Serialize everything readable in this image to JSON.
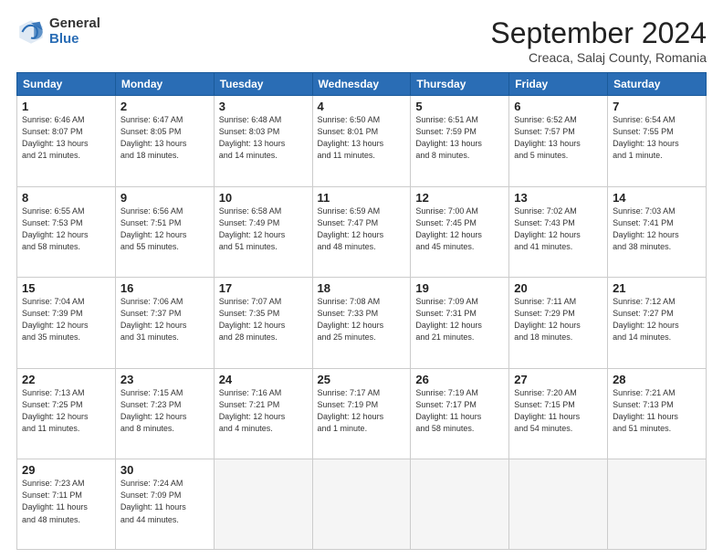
{
  "logo": {
    "general": "General",
    "blue": "Blue"
  },
  "title": "September 2024",
  "subtitle": "Creaca, Salaj County, Romania",
  "headers": [
    "Sunday",
    "Monday",
    "Tuesday",
    "Wednesday",
    "Thursday",
    "Friday",
    "Saturday"
  ],
  "days": [
    {
      "num": "",
      "info": ""
    },
    {
      "num": "",
      "info": ""
    },
    {
      "num": "",
      "info": ""
    },
    {
      "num": "",
      "info": ""
    },
    {
      "num": "",
      "info": ""
    },
    {
      "num": "",
      "info": ""
    },
    {
      "num": "1",
      "info": "Sunrise: 6:46 AM\nSunset: 8:07 PM\nDaylight: 13 hours\nand 21 minutes."
    },
    {
      "num": "2",
      "info": "Sunrise: 6:47 AM\nSunset: 8:05 PM\nDaylight: 13 hours\nand 18 minutes."
    },
    {
      "num": "3",
      "info": "Sunrise: 6:48 AM\nSunset: 8:03 PM\nDaylight: 13 hours\nand 14 minutes."
    },
    {
      "num": "4",
      "info": "Sunrise: 6:50 AM\nSunset: 8:01 PM\nDaylight: 13 hours\nand 11 minutes."
    },
    {
      "num": "5",
      "info": "Sunrise: 6:51 AM\nSunset: 7:59 PM\nDaylight: 13 hours\nand 8 minutes."
    },
    {
      "num": "6",
      "info": "Sunrise: 6:52 AM\nSunset: 7:57 PM\nDaylight: 13 hours\nand 5 minutes."
    },
    {
      "num": "7",
      "info": "Sunrise: 6:54 AM\nSunset: 7:55 PM\nDaylight: 13 hours\nand 1 minute."
    },
    {
      "num": "8",
      "info": "Sunrise: 6:55 AM\nSunset: 7:53 PM\nDaylight: 12 hours\nand 58 minutes."
    },
    {
      "num": "9",
      "info": "Sunrise: 6:56 AM\nSunset: 7:51 PM\nDaylight: 12 hours\nand 55 minutes."
    },
    {
      "num": "10",
      "info": "Sunrise: 6:58 AM\nSunset: 7:49 PM\nDaylight: 12 hours\nand 51 minutes."
    },
    {
      "num": "11",
      "info": "Sunrise: 6:59 AM\nSunset: 7:47 PM\nDaylight: 12 hours\nand 48 minutes."
    },
    {
      "num": "12",
      "info": "Sunrise: 7:00 AM\nSunset: 7:45 PM\nDaylight: 12 hours\nand 45 minutes."
    },
    {
      "num": "13",
      "info": "Sunrise: 7:02 AM\nSunset: 7:43 PM\nDaylight: 12 hours\nand 41 minutes."
    },
    {
      "num": "14",
      "info": "Sunrise: 7:03 AM\nSunset: 7:41 PM\nDaylight: 12 hours\nand 38 minutes."
    },
    {
      "num": "15",
      "info": "Sunrise: 7:04 AM\nSunset: 7:39 PM\nDaylight: 12 hours\nand 35 minutes."
    },
    {
      "num": "16",
      "info": "Sunrise: 7:06 AM\nSunset: 7:37 PM\nDaylight: 12 hours\nand 31 minutes."
    },
    {
      "num": "17",
      "info": "Sunrise: 7:07 AM\nSunset: 7:35 PM\nDaylight: 12 hours\nand 28 minutes."
    },
    {
      "num": "18",
      "info": "Sunrise: 7:08 AM\nSunset: 7:33 PM\nDaylight: 12 hours\nand 25 minutes."
    },
    {
      "num": "19",
      "info": "Sunrise: 7:09 AM\nSunset: 7:31 PM\nDaylight: 12 hours\nand 21 minutes."
    },
    {
      "num": "20",
      "info": "Sunrise: 7:11 AM\nSunset: 7:29 PM\nDaylight: 12 hours\nand 18 minutes."
    },
    {
      "num": "21",
      "info": "Sunrise: 7:12 AM\nSunset: 7:27 PM\nDaylight: 12 hours\nand 14 minutes."
    },
    {
      "num": "22",
      "info": "Sunrise: 7:13 AM\nSunset: 7:25 PM\nDaylight: 12 hours\nand 11 minutes."
    },
    {
      "num": "23",
      "info": "Sunrise: 7:15 AM\nSunset: 7:23 PM\nDaylight: 12 hours\nand 8 minutes."
    },
    {
      "num": "24",
      "info": "Sunrise: 7:16 AM\nSunset: 7:21 PM\nDaylight: 12 hours\nand 4 minutes."
    },
    {
      "num": "25",
      "info": "Sunrise: 7:17 AM\nSunset: 7:19 PM\nDaylight: 12 hours\nand 1 minute."
    },
    {
      "num": "26",
      "info": "Sunrise: 7:19 AM\nSunset: 7:17 PM\nDaylight: 11 hours\nand 58 minutes."
    },
    {
      "num": "27",
      "info": "Sunrise: 7:20 AM\nSunset: 7:15 PM\nDaylight: 11 hours\nand 54 minutes."
    },
    {
      "num": "28",
      "info": "Sunrise: 7:21 AM\nSunset: 7:13 PM\nDaylight: 11 hours\nand 51 minutes."
    },
    {
      "num": "29",
      "info": "Sunrise: 7:23 AM\nSunset: 7:11 PM\nDaylight: 11 hours\nand 48 minutes."
    },
    {
      "num": "30",
      "info": "Sunrise: 7:24 AM\nSunset: 7:09 PM\nDaylight: 11 hours\nand 44 minutes."
    },
    {
      "num": "",
      "info": ""
    },
    {
      "num": "",
      "info": ""
    },
    {
      "num": "",
      "info": ""
    },
    {
      "num": "",
      "info": ""
    },
    {
      "num": "",
      "info": ""
    }
  ]
}
